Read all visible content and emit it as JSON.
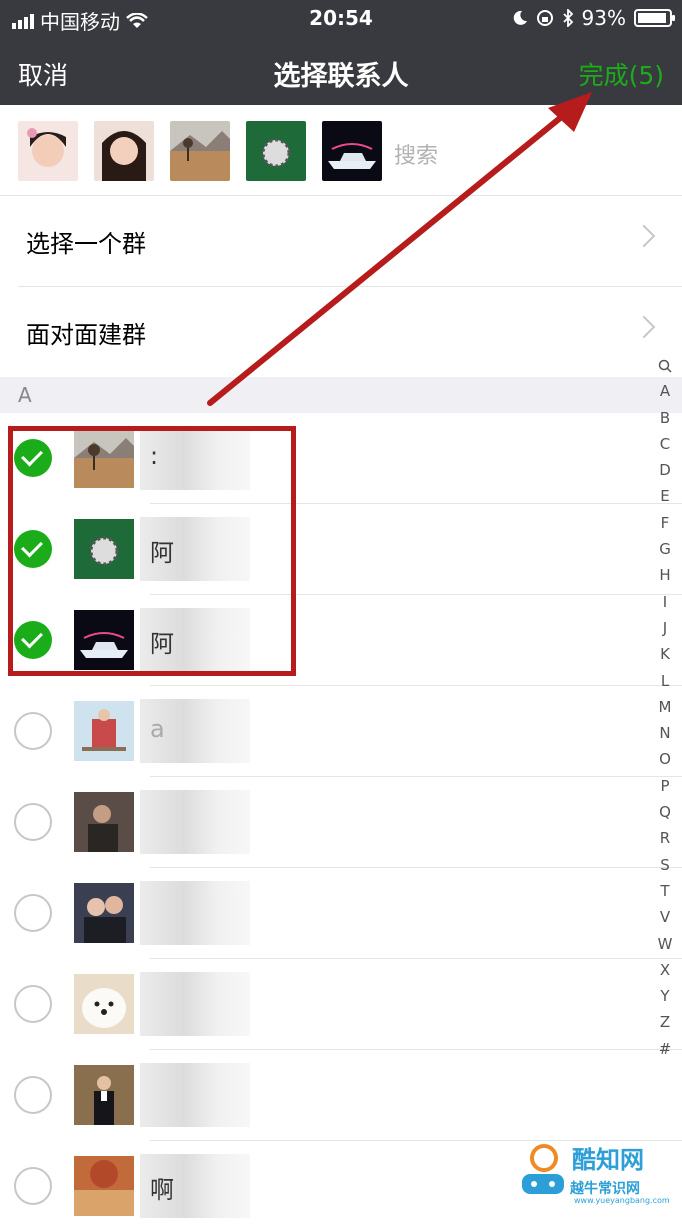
{
  "status_bar": {
    "carrier": "中国移动",
    "time": "20:54",
    "battery": "93%",
    "battery_level": 0.93
  },
  "nav": {
    "cancel_label": "取消",
    "title": "选择联系人",
    "done_label": "完成(5)"
  },
  "selected_avatars": [
    "avatar-girl-1",
    "avatar-girl-2",
    "avatar-landscape",
    "avatar-ball",
    "avatar-yacht"
  ],
  "search": {
    "placeholder": "搜索"
  },
  "menu": [
    {
      "label": "选择一个群"
    },
    {
      "label": "面对面建群"
    }
  ],
  "section_letter": "A",
  "contacts": [
    {
      "checked": true,
      "name": ": "
    },
    {
      "checked": true,
      "name": "阿"
    },
    {
      "checked": true,
      "name": "阿"
    },
    {
      "checked": false,
      "name": "a"
    },
    {
      "checked": false,
      "name": ""
    },
    {
      "checked": false,
      "name": ""
    },
    {
      "checked": false,
      "name": ""
    },
    {
      "checked": false,
      "name": ""
    },
    {
      "checked": false,
      "name": "啊"
    }
  ],
  "index_letters": [
    "A",
    "B",
    "C",
    "D",
    "E",
    "F",
    "G",
    "H",
    "I",
    "J",
    "K",
    "L",
    "M",
    "N",
    "O",
    "P",
    "Q",
    "R",
    "S",
    "T",
    "V",
    "W",
    "X",
    "Y",
    "Z",
    "#"
  ],
  "watermark": {
    "title": "酷知网",
    "subtitle": "越牛常识网",
    "url": "www.yueyangbang.com"
  },
  "colors": {
    "nav_bg": "#393a3f",
    "accent_green": "#1aad19",
    "annotation_red": "#b71c1c",
    "section_bg": "#efeff4"
  }
}
